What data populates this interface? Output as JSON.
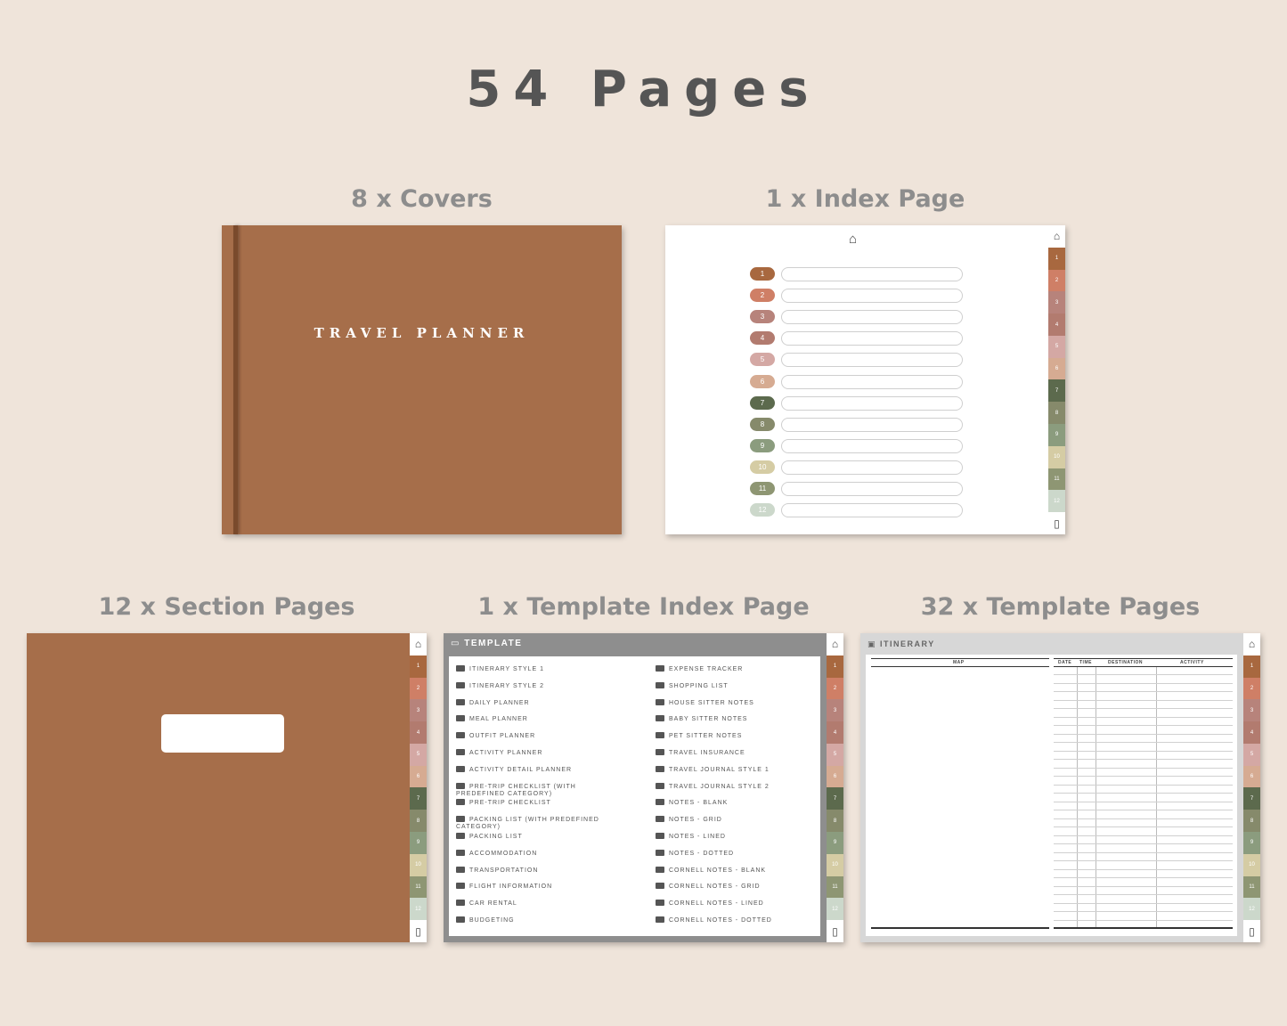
{
  "title": "54 Pages",
  "captions": {
    "covers": "8 x Covers",
    "index": "1 x Index Page",
    "sections": "12 x Section Pages",
    "template_index": "1 x Template Index Page",
    "template_pages": "32 x Template Pages"
  },
  "cover": {
    "title": "TRAVEL PLANNER",
    "color": "#a66e4a"
  },
  "tabs": [
    {
      "label": "1",
      "color": "#a8683f"
    },
    {
      "label": "2",
      "color": "#cf7f66"
    },
    {
      "label": "3",
      "color": "#b7837b"
    },
    {
      "label": "4",
      "color": "#b27b6f"
    },
    {
      "label": "5",
      "color": "#d4a8a4"
    },
    {
      "label": "6",
      "color": "#d6ab92"
    },
    {
      "label": "7",
      "color": "#5c6a4d"
    },
    {
      "label": "8",
      "color": "#868a6b"
    },
    {
      "label": "9",
      "color": "#8b9c7e"
    },
    {
      "label": "10",
      "color": "#d5cca4"
    },
    {
      "label": "11",
      "color": "#8e9673"
    },
    {
      "label": "12",
      "color": "#ccd8cb"
    }
  ],
  "template_index": {
    "header": "TEMPLATE",
    "left_items": [
      "ITINERARY STYLE 1",
      "ITINERARY STYLE 2",
      "DAILY PLANNER",
      "MEAL PLANNER",
      "OUTFIT PLANNER",
      "ACTIVITY PLANNER",
      "ACTIVITY DETAIL PLANNER",
      "PRE-TRIP CHECKLIST (WITH PREDEFINED CATEGORY)",
      "PRE-TRIP CHECKLIST",
      "PACKING LIST (WITH PREDEFINED CATEGORY)",
      "PACKING LIST",
      "ACCOMMODATION",
      "TRANSPORTATION",
      "FLIGHT INFORMATION",
      "CAR RENTAL",
      "BUDGETING"
    ],
    "right_items": [
      "EXPENSE TRACKER",
      "SHOPPING LIST",
      "HOUSE SITTER NOTES",
      "BABY SITTER NOTES",
      "PET SITTER NOTES",
      "TRAVEL INSURANCE",
      "TRAVEL JOURNAL STYLE 1",
      "TRAVEL JOURNAL STYLE 2",
      "NOTES - BLANK",
      "NOTES - GRID",
      "NOTES - LINED",
      "NOTES - DOTTED",
      "CORNELL NOTES - BLANK",
      "CORNELL NOTES - GRID",
      "CORNELL NOTES - LINED",
      "CORNELL NOTES - DOTTED"
    ]
  },
  "template_page": {
    "header": "ITINERARY",
    "map_label": "MAP",
    "columns": [
      "DATE",
      "TIME",
      "DESTINATION",
      "ACTIVITY"
    ]
  }
}
